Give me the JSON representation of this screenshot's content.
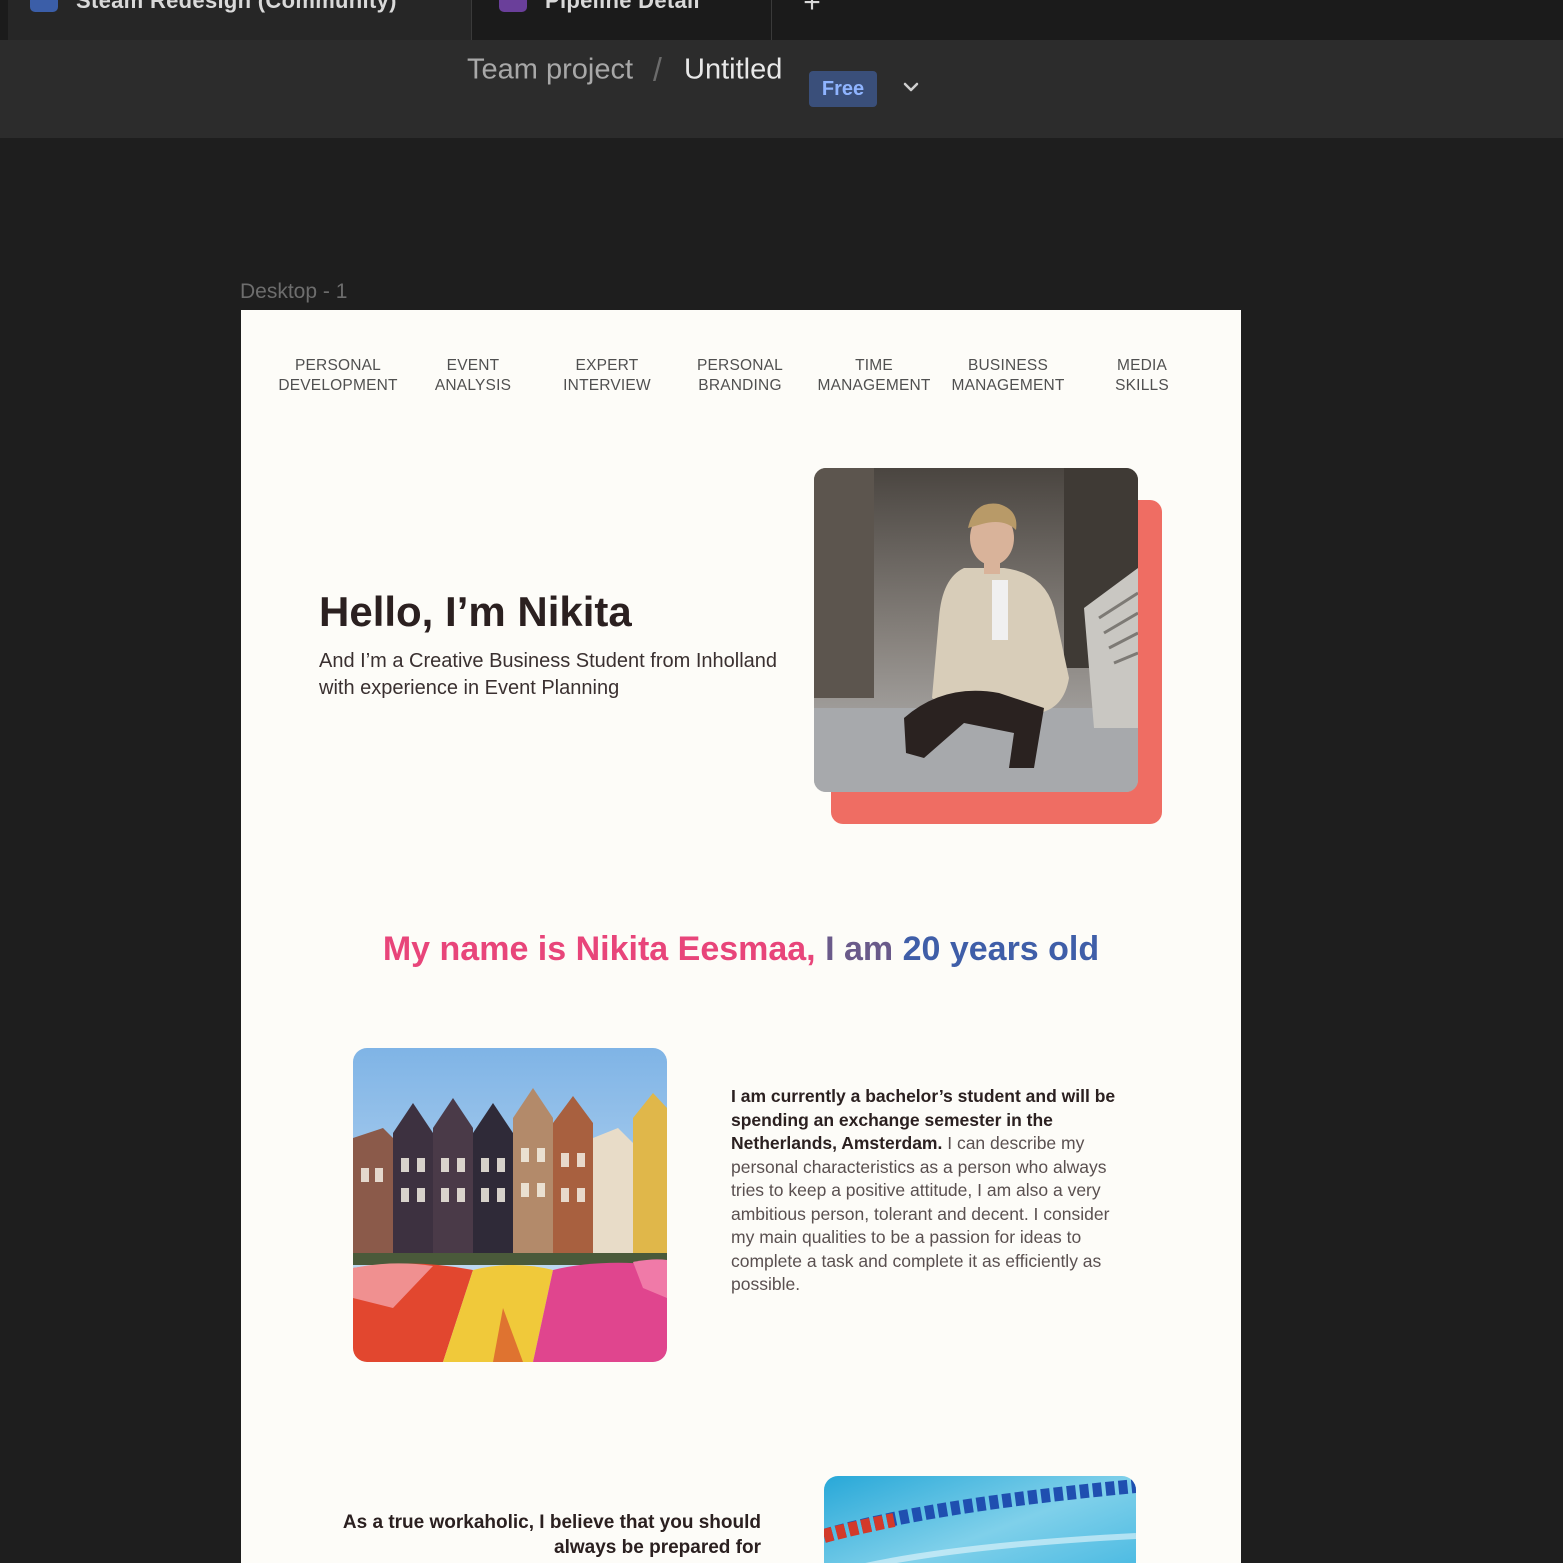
{
  "tabs": [
    {
      "label": "Steam Redesign (Community)"
    },
    {
      "label": "Pipeline Detail"
    }
  ],
  "new_tab_label": "+",
  "breadcrumb": {
    "team": "Team project",
    "separator": "/",
    "file": "Untitled",
    "plan_badge": "Free"
  },
  "frame_label": "Desktop - 1",
  "site": {
    "nav": [
      "Personal\nDevelopment",
      "Event\nAnalysis",
      "Expert\nInterview",
      "Personal\nBranding",
      "Time\nManagement",
      "Business\nManagement",
      "Media\nSkills"
    ],
    "hero_title": "Hello, I’m Nikita",
    "hero_subtitle": "And I’m a Creative Business Student from Inholland with experience in Event Planning",
    "intro": {
      "part1": "My name is Nikita Eesmaa,",
      "part2": " I am ",
      "part3": "20 years old"
    },
    "about_lead": "I am currently a bachelor’s student and will be spending an exchange semester in the Netherlands, Amsterdam.",
    "about_body": " I can describe my personal characteristics as a person who always tries to keep a positive attitude, I am also a very ambitious person, tolerant and decent. I consider my main qualities to be a passion for ideas to complete a task and complete it as efficiently as possible.",
    "work_text": "As a true workaholic, I believe that you should always be prepared for"
  },
  "colors": {
    "accent_coral": "#ef6d63",
    "intro_pink": "#e8457a",
    "intro_blue": "#3f5ea8",
    "badge_bg": "#3a4f7a"
  }
}
